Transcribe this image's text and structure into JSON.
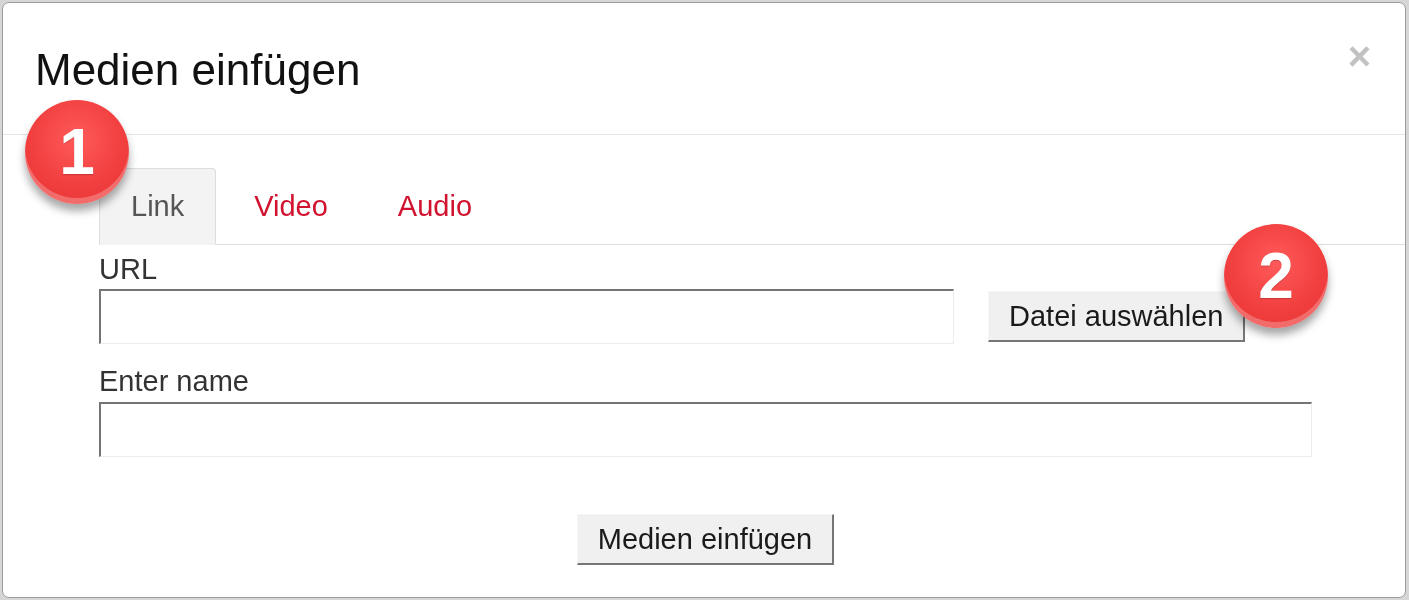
{
  "dialog": {
    "title": "Medien einfügen",
    "close_label": "×"
  },
  "tabs": [
    {
      "label": "Link",
      "selected": true
    },
    {
      "label": "Video",
      "selected": false
    },
    {
      "label": "Audio",
      "selected": false
    }
  ],
  "fields": [
    {
      "label": "URL",
      "button": "Datei auswählen"
    },
    {
      "label": "Enter name"
    }
  ],
  "submit_button": "Medien einfügen",
  "callouts": [
    {
      "number": "1"
    },
    {
      "number": "2"
    }
  ]
}
